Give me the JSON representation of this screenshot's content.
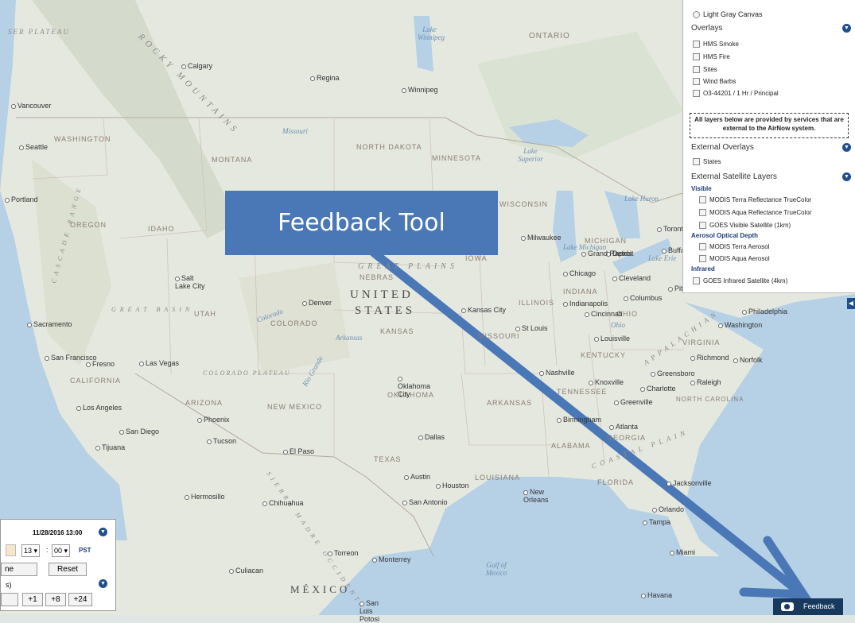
{
  "map_labels": {
    "provinces": [
      "ONTARIO"
    ],
    "states": [
      "WASHINGTON",
      "MONTANA",
      "NORTH DAKOTA",
      "MINNESOTA",
      "WISCONSIN",
      "OREGON",
      "IDAHO",
      "UTAH",
      "COLORADO",
      "IOWA",
      "NEBRAS",
      "KANSAS",
      "ILLINOIS",
      "INDIANA",
      "OHIO",
      "MICHIGAN",
      "MISSOURI",
      "KENTUCKY",
      "VIRGINIA",
      "OKLAHOMA",
      "ARKANSAS",
      "TENNESSEE",
      "NORTH CAROLINA",
      "CALIFORNIA",
      "ARIZONA",
      "NEW MEXICO",
      "TEXAS",
      "LOUISIANA",
      "ALABAMA",
      "GEORGIA",
      "FLORIDA"
    ],
    "country_us_1": "UNITED",
    "country_us_2": "STATES",
    "country_mx": "MÉXICO",
    "regions": [
      "ROCKY MOUNTAINS",
      "GREAT PLAINS",
      "GREAT BASIN",
      "COLORADO PLATEAU",
      "CASCADE RANGE",
      "SIERRA MADRE OCCIDENTAL",
      "APPALACHIAN",
      "COASTAL PLAIN",
      "SER PLATEAU"
    ],
    "cities": [
      "Calgary",
      "Regina",
      "Winnipeg",
      "Vancouver",
      "Seattle",
      "Portland",
      "Salt Lake City",
      "Denver",
      "Sacramento",
      "San Francisco",
      "Fresno",
      "Las Vegas",
      "Los Angeles",
      "San Diego",
      "Tijuana",
      "Phoenix",
      "Tucson",
      "El Paso",
      "Hermosillo",
      "Chihuahua",
      "Culiacan",
      "Torreon",
      "Monterrey",
      "San Luis Potosi",
      "Oklahoma City",
      "Dallas",
      "Austin",
      "San Antonio",
      "Houston",
      "New Orleans",
      "Kansas City",
      "St Louis",
      "Chicago",
      "Milwaukee",
      "Detroit",
      "Grand Rapids",
      "Indianapolis",
      "Cincinnati",
      "Columbus",
      "Cleveland",
      "Louisville",
      "Nashville",
      "Knoxville",
      "Atlanta",
      "Birmingham",
      "Charlotte",
      "Greensboro",
      "Raleigh",
      "Greenville",
      "Richmond",
      "Norfolk",
      "Washington",
      "Philadelphia",
      "Toronto",
      "Buffalo",
      "Pittsburgh",
      "Jacksonville",
      "Orlando",
      "Tampa",
      "Miami",
      "Havana"
    ],
    "water": [
      "Lake Winnipeg",
      "Lake Superior",
      "Lake Michigan",
      "Lake Huron",
      "Lake Erie",
      "Gulf of Mexico",
      "Missouri",
      "Ohio",
      "Arkansas",
      "Colorado",
      "Rio Grande"
    ]
  },
  "layer_panel": {
    "basemap_option": "Light Gray Canvas",
    "overlays_title": "Overlays",
    "overlays": [
      "HMS Smoke",
      "HMS Fire",
      "Sites",
      "Wind Barbs",
      "O3-44201 / 1 Hr / Principal"
    ],
    "notice": "All layers below are provided by services that are external to the AirNow system.",
    "external_overlays_title": "External Overlays",
    "external_overlays": [
      "States"
    ],
    "satellite_title": "External Satellite Layers",
    "visible_head": "Visible",
    "visible_layers": [
      "MODIS Terra Reflectance TrueColor",
      "MODIS Aqua Reflectance TrueColor",
      "GOES Visible Satellite (1km)"
    ],
    "aerosol_head": "Aerosol Optical Depth",
    "aerosol_layers": [
      "MODIS Terra Aerosol",
      "MODIS Aqua Aerosol"
    ],
    "infrared_head": "Infrared",
    "infrared_layers": [
      "GOES Infrared Satellite (4km)"
    ]
  },
  "time_panel": {
    "datetime": "11/28/2016 13:00",
    "hour": "13",
    "minute": "00",
    "timezone": "PST",
    "now_button_partial": "ne",
    "reset_button": "Reset",
    "hours_label_partial": "s)",
    "step_buttons": [
      "+1",
      "+8",
      "+24"
    ]
  },
  "callout": "Feedback Tool",
  "feedback_button": "Feedback",
  "colors": {
    "accent": "#1f4e8c",
    "callout": "#4a78b6",
    "feedback_bg": "#17395e",
    "water": "#b6d0e6",
    "land": "#e6e8df"
  }
}
